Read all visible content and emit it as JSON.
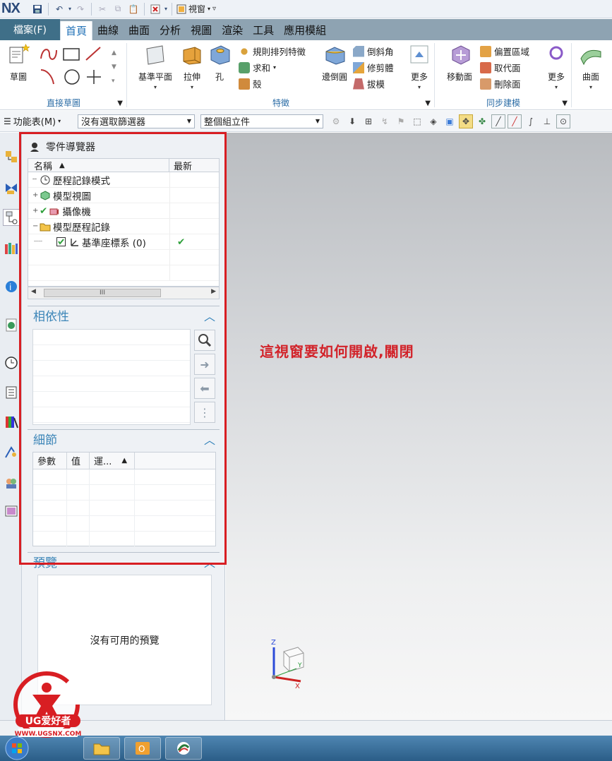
{
  "quick_access": {
    "logo": "NX",
    "view_window": "視窗"
  },
  "tabs": {
    "file": "檔案(F)",
    "items": [
      "首頁",
      "曲線",
      "曲面",
      "分析",
      "視圖",
      "渲染",
      "工具",
      "應用模組"
    ],
    "active": "首頁"
  },
  "ribbon": {
    "direct_sketch": {
      "sketch": "草圖",
      "group_label": "直接草圖"
    },
    "feature": {
      "datum_plane": "基準平面",
      "extrude": "拉伸",
      "hole": "孔",
      "pattern": "規則排列特徵",
      "unite": "求和",
      "shell": "殼",
      "edge_blend": "邊倒圓",
      "chamfer": "倒斜角",
      "trim_body": "修剪體",
      "draft": "拔模",
      "more": "更多",
      "group_label": "特徵"
    },
    "sync": {
      "move_face": "移動面",
      "offset_region": "偏置區域",
      "replace_face": "取代面",
      "delete_face": "刪除面",
      "more": "更多",
      "group_label": "同步建模"
    },
    "surface": {
      "label": "曲面"
    }
  },
  "toolbar": {
    "menu": "功能表(M)",
    "selection_filter": "沒有選取篩選器",
    "scope": "整個組立件"
  },
  "navigator": {
    "title": "零件導覽器",
    "col_name": "名稱",
    "col_latest": "最新",
    "tree": [
      {
        "label": "歷程記錄模式",
        "expander": "",
        "check": ""
      },
      {
        "label": "模型視圖",
        "expander": "+",
        "check": ""
      },
      {
        "label": "攝像機",
        "expander": "+",
        "check": ""
      },
      {
        "label": "模型歷程記錄",
        "expander": "−",
        "check": ""
      },
      {
        "label": "基準座標系 (0)",
        "expander": "",
        "check": "✔"
      }
    ],
    "scroll_thumb": "III",
    "dependency": "相依性",
    "details": "細節",
    "details_cols": [
      "參數",
      "值",
      "運..."
    ],
    "preview": "預覽",
    "no_preview": "沒有可用的預覽"
  },
  "graphics": {
    "annotation": "這視窗要如何開啟,關閉",
    "axis_x": "X",
    "axis_y": "Y",
    "axis_z": "Z"
  },
  "watermark": {
    "brand": "UG爱好者",
    "url": "WWW.UGSNX.COM"
  },
  "colors": {
    "tab_bar": "#8ea3b2",
    "file_tab": "#3f6f88",
    "group_label": "#2c6da6",
    "highlight": "#d81e23",
    "annotation": "#d2232a",
    "check": "#2fa03b"
  }
}
